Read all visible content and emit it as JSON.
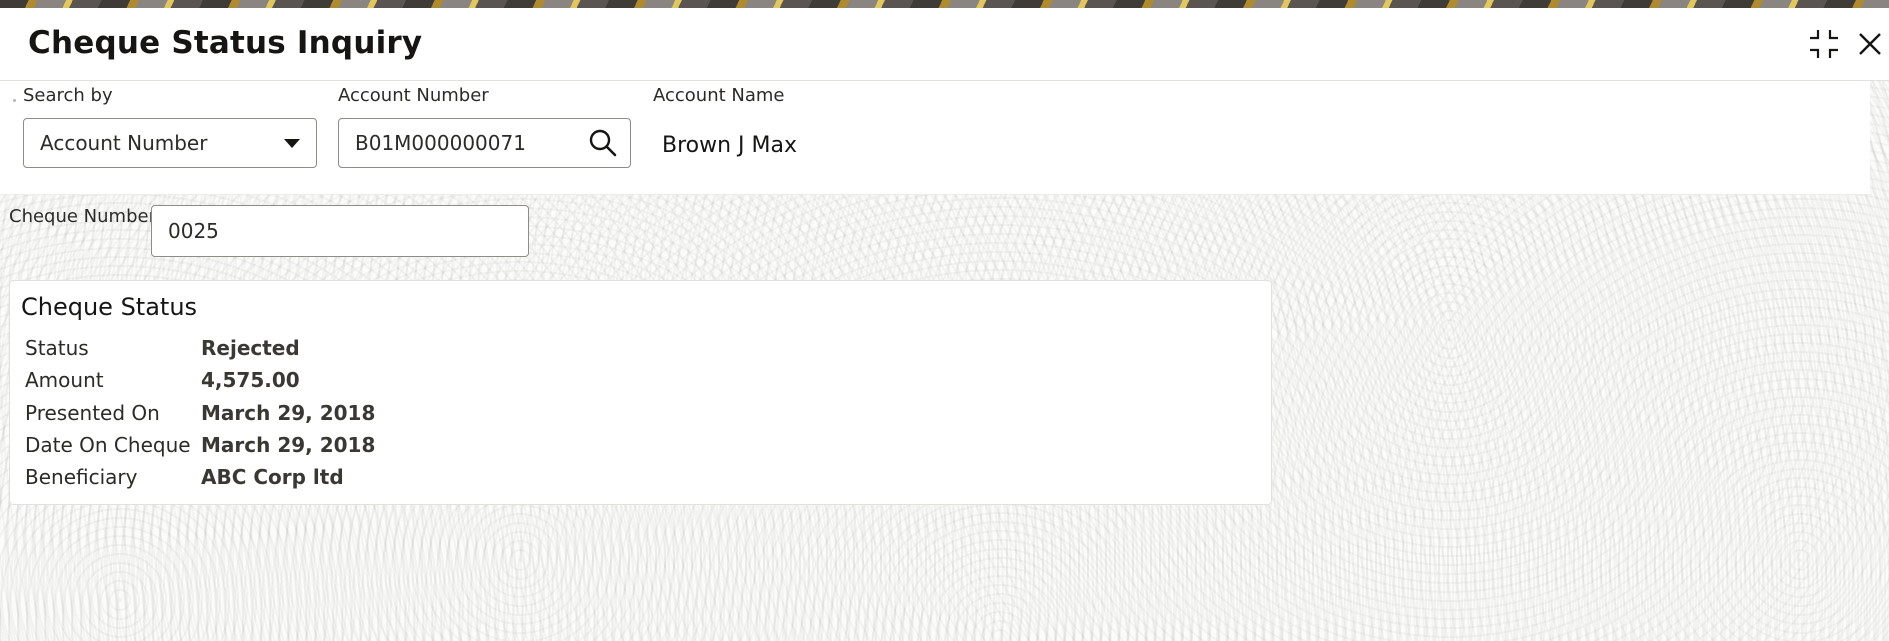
{
  "header": {
    "title": "Cheque Status Inquiry",
    "icons": [
      "collapse-icon",
      "close-icon"
    ]
  },
  "search": {
    "search_by_label": "Search by",
    "search_by_value": "Account Number",
    "account_number_label": "Account Number",
    "account_number_value": "B01M000000071",
    "account_name_label": "Account Name",
    "account_name_value": "Brown J Max"
  },
  "cheque": {
    "number_label": "Cheque Number",
    "number_value": "0025"
  },
  "cheque_status": {
    "title": "Cheque Status",
    "rows": [
      {
        "label": "Status",
        "value": "Rejected"
      },
      {
        "label": "Amount",
        "value": "4,575.00"
      },
      {
        "label": "Presented On",
        "value": "March 29, 2018"
      },
      {
        "label": "Date On Cheque",
        "value": "March 29, 2018"
      },
      {
        "label": "Beneficiary",
        "value": "ABC Corp ltd"
      }
    ]
  },
  "colors": {
    "text": "#161513",
    "border": "#8f8b86"
  }
}
